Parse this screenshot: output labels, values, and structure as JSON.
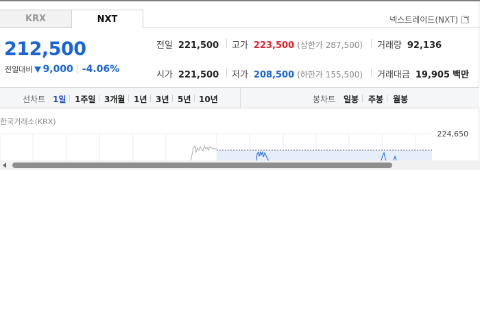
{
  "tabs": [
    {
      "label": "KRX",
      "active": false
    },
    {
      "label": "NXT",
      "active": true
    }
  ],
  "nxt_link": {
    "label": "넥스트레이드(NXT)",
    "icon": "external-link-icon"
  },
  "quote": {
    "price": "212,500",
    "change_label": "전일대비",
    "change_icon": "down-triangle-icon",
    "change_value": "9,000",
    "change_pct": "-4.06%",
    "color_down": "#1a64d6",
    "color_up": "#e0202a"
  },
  "stats": {
    "prev_close": {
      "label": "전일",
      "value": "221,500"
    },
    "high": {
      "label": "고가",
      "value": "223,500",
      "sub": "(상한가 287,500)"
    },
    "volume": {
      "label": "거래량",
      "value": "92,136"
    },
    "open": {
      "label": "시가",
      "value": "221,500"
    },
    "low": {
      "label": "저가",
      "value": "208,500",
      "sub": "(하한가 155,500)"
    },
    "amount": {
      "label": "거래대금",
      "value": "19,905",
      "unit": "백만"
    }
  },
  "line_chart": {
    "label": "선차트",
    "periods": [
      "1일",
      "1주일",
      "3개월",
      "1년",
      "3년",
      "5년",
      "10년"
    ],
    "active": "1일"
  },
  "candle_chart": {
    "label": "봉차트",
    "periods": [
      "일봉",
      "주봉",
      "월봉"
    ]
  },
  "chart": {
    "source_label": "한국거래소(KRX)",
    "y_tick_top": "224,650"
  }
}
